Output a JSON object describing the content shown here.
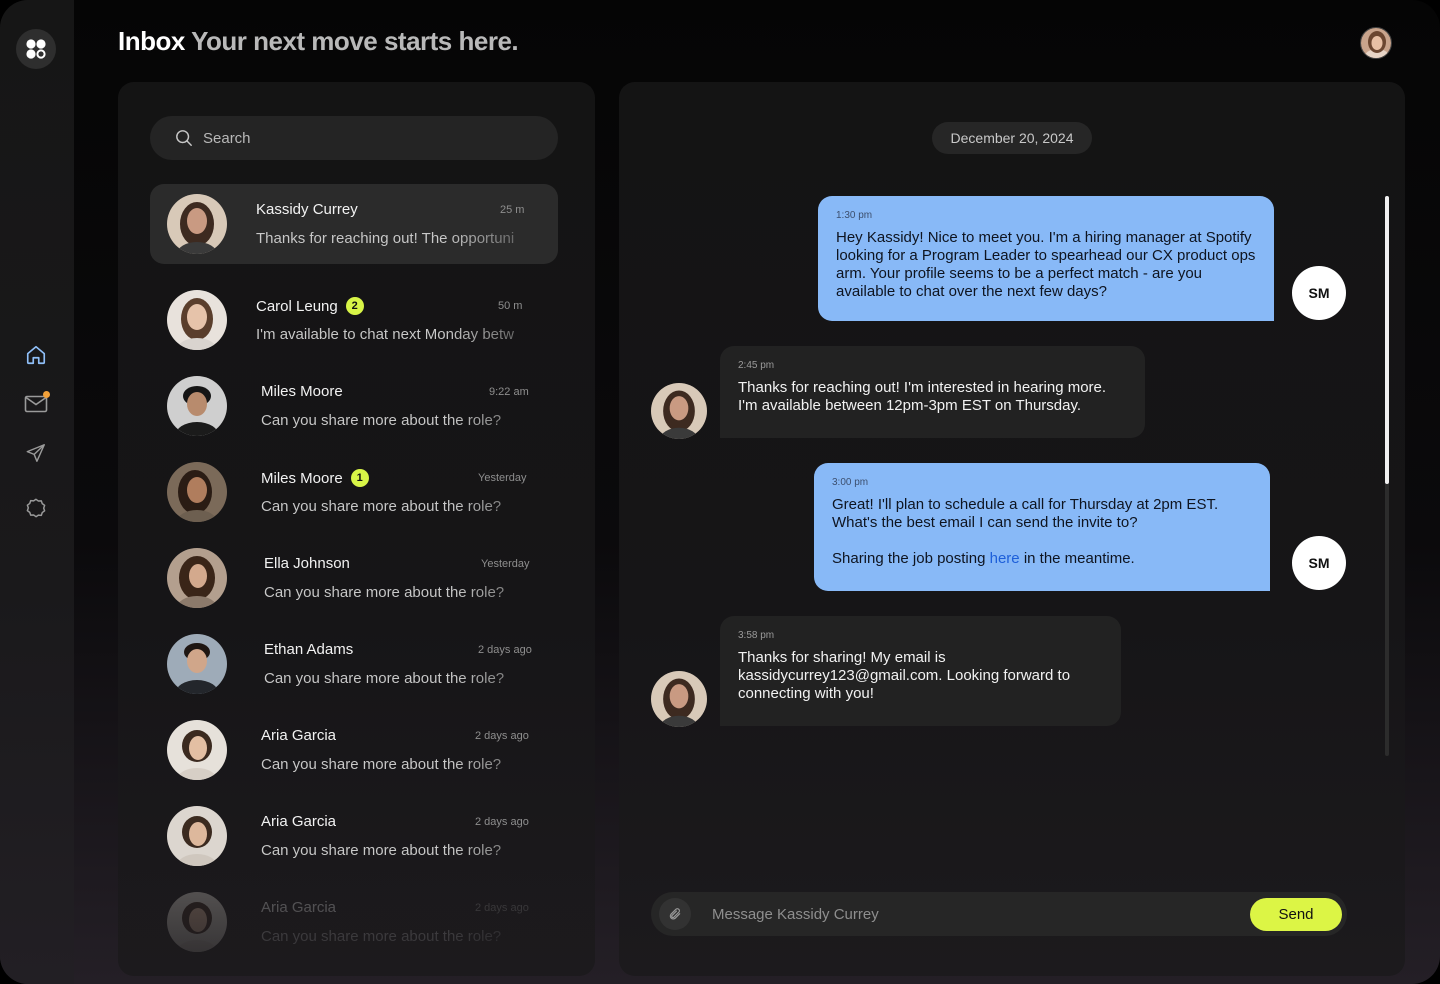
{
  "header": {
    "title": "Inbox",
    "subtitle": "Your next move starts here."
  },
  "nav": {
    "items": [
      {
        "icon": "home-icon",
        "active": true
      },
      {
        "icon": "mail-icon",
        "notification": true
      },
      {
        "icon": "send-icon"
      },
      {
        "icon": "badge-icon"
      }
    ]
  },
  "search": {
    "placeholder": "Search"
  },
  "conversations": [
    {
      "name": "Kassidy Currey",
      "time": "25 m",
      "preview": "Thanks for reaching out! The opportuni",
      "badge": null,
      "active": true
    },
    {
      "name": "Carol Leung",
      "time": "50 m",
      "preview": "I'm available to chat next Monday betw",
      "badge": "2"
    },
    {
      "name": "Miles Moore",
      "time": "9:22 am",
      "preview": "Can you share more about the role?",
      "badge": null
    },
    {
      "name": "Miles Moore",
      "time": "Yesterday",
      "preview": "Can you share more about the role?",
      "badge": "1"
    },
    {
      "name": "Ella Johnson",
      "time": "Yesterday",
      "preview": "Can you share more about the role?",
      "badge": null
    },
    {
      "name": "Ethan Adams",
      "time": "2 days ago",
      "preview": "Can you share more about the role?",
      "badge": null
    },
    {
      "name": "Aria Garcia",
      "time": "2 days ago",
      "preview": "Can you share more about the role?",
      "badge": null
    },
    {
      "name": "Aria Garcia",
      "time": "2 days ago",
      "preview": "Can you share more about the role?",
      "badge": null
    },
    {
      "name": "Aria Garcia",
      "time": "2 days ago",
      "preview": "Can you share more about the role?",
      "badge": null
    }
  ],
  "chat": {
    "date": "December 20, 2024",
    "messages": [
      {
        "direction": "out",
        "time": "1:30 pm",
        "text": "Hey Kassidy! Nice to meet you. I'm a hiring manager at Spotify looking for a Program Leader to spearhead our CX product ops arm. Your profile seems to be a perfect match - are you available to chat over the next few days?",
        "sender": "SM"
      },
      {
        "direction": "in",
        "time": "2:45 pm",
        "text": "Thanks for reaching out! I'm interested in hearing more. I'm available between 12pm-3pm EST on Thursday."
      },
      {
        "direction": "out",
        "time": "3:00 pm",
        "text": "Great! I'll plan to schedule a call for Thursday at 2pm EST. What's the best email I can send the invite to?",
        "text2_before": "Sharing the job posting ",
        "link": "here",
        "text2_after": " in the meantime.",
        "sender": "SM"
      },
      {
        "direction": "in",
        "time": "3:58 pm",
        "text": "Thanks for sharing! My email is kassidycurrey123@gmail.com. Looking forward to connecting with you!"
      }
    ],
    "composer": {
      "placeholder": "Message Kassidy Currey",
      "send_label": "Send"
    }
  },
  "colors": {
    "accent": "#dcf545",
    "bubble_out": "#88b9f7",
    "bubble_in": "#222222",
    "link": "#1d5fd9",
    "notification": "#f2a13a"
  }
}
